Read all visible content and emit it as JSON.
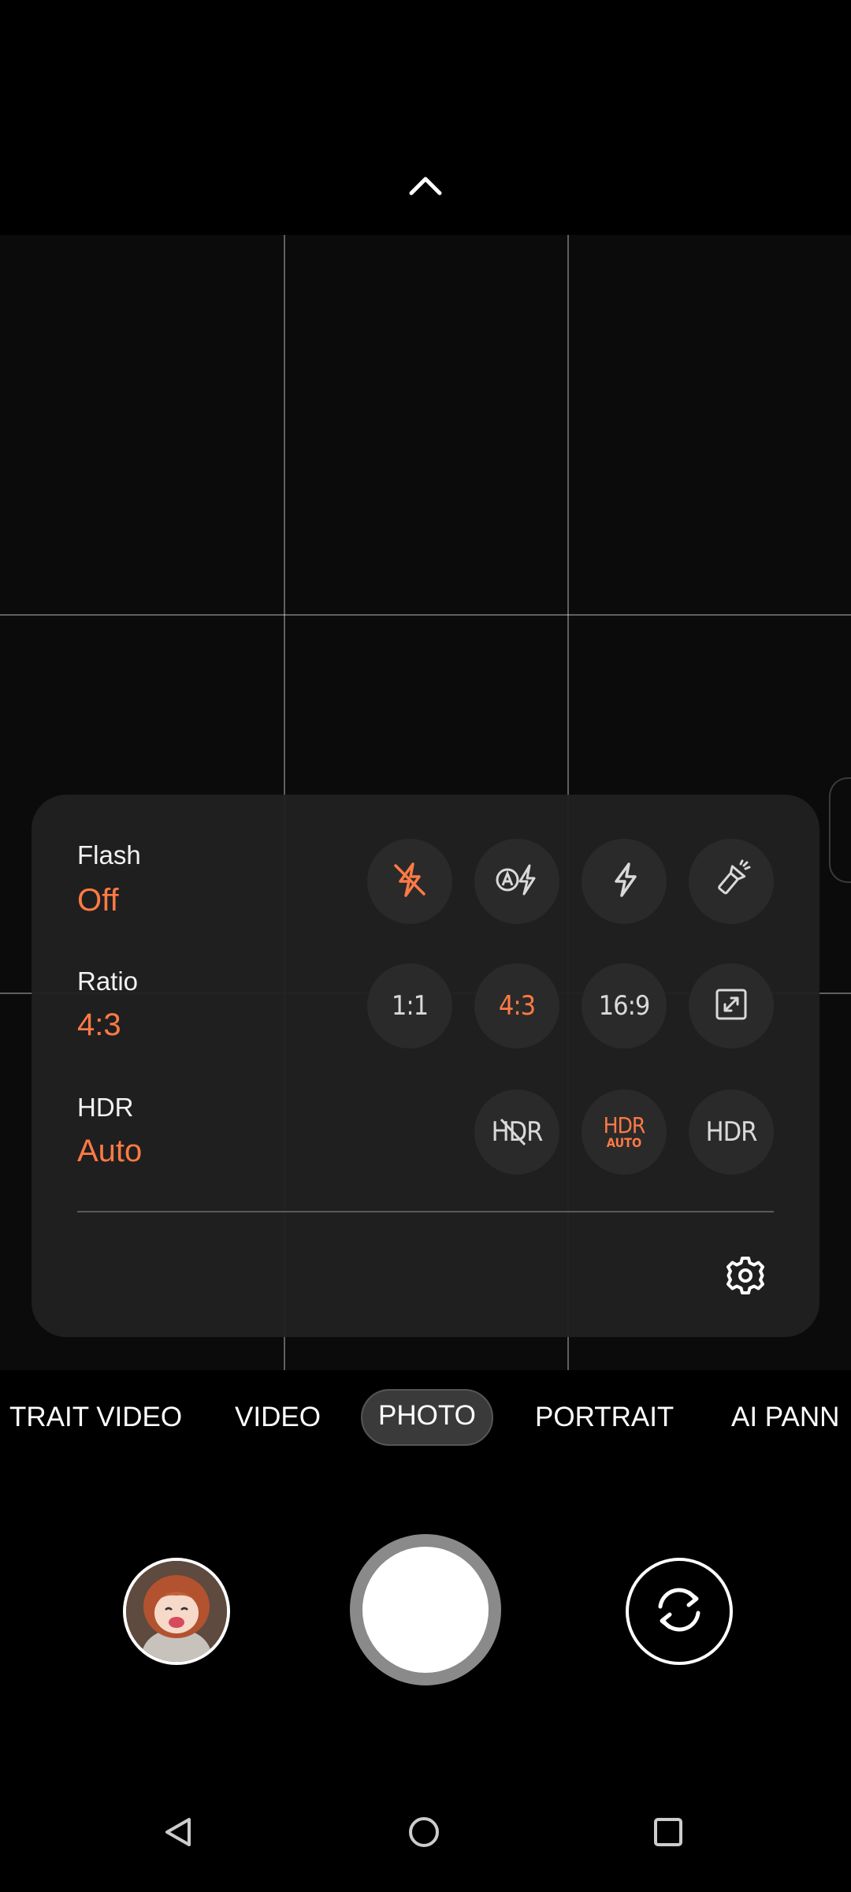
{
  "quick_settings": {
    "flash": {
      "label": "Flash",
      "value": "Off",
      "options": [
        {
          "icon": "flash-off-icon",
          "active": true
        },
        {
          "icon": "flash-auto-icon",
          "active": false
        },
        {
          "icon": "flash-on-icon",
          "active": false
        },
        {
          "icon": "torch-icon",
          "active": false
        }
      ]
    },
    "ratio": {
      "label": "Ratio",
      "value": "4:3",
      "options": [
        "1:1",
        "4:3",
        "16:9"
      ],
      "active_option": "4:3",
      "extra_icon": "fullscreen-expand-icon"
    },
    "hdr": {
      "label": "HDR",
      "value": "Auto",
      "options": [
        "HDR",
        "HDR",
        "HDR"
      ],
      "auto_sub": "AUTO",
      "active_option_index": 1
    },
    "settings_icon": "gear-icon"
  },
  "modes": {
    "items": [
      "TRAIT VIDEO",
      "VIDEO",
      "PHOTO",
      "PORTRAIT",
      "AI PANN"
    ],
    "selected": "PHOTO"
  },
  "colors": {
    "accent": "#ff7a45",
    "panel": "#202020",
    "background": "#000000"
  }
}
